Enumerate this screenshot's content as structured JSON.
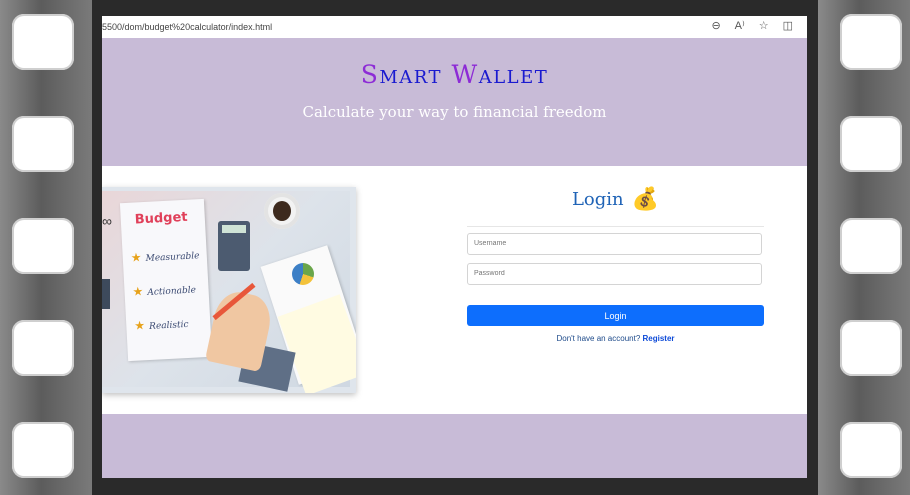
{
  "browser": {
    "url": "5500/dom/budget%20calculator/index.html",
    "icons": [
      "zoom-out-icon",
      "read-aloud-icon",
      "favorite-star-icon",
      "split-screen-icon"
    ]
  },
  "header": {
    "brand_first": "S",
    "brand_rest_a": "mart ",
    "brand_second": "W",
    "brand_rest_b": "allet",
    "tagline": "Calculate your way to financial freedom"
  },
  "hero": {
    "paper_title": "Budget",
    "items": [
      "Measurable",
      "Actionable",
      "Realistic"
    ],
    "calculator_display": "00000"
  },
  "login": {
    "title": "Login",
    "username_placeholder": "Username",
    "password_placeholder": "Password",
    "button_label": "Login",
    "register_prompt": "Don't have an account?",
    "register_link": "Register"
  },
  "colors": {
    "header_bg": "#c8bbd7",
    "brand_blue": "#1a1ad0",
    "brand_purple": "#8d2bd6",
    "login_title": "#1f63b6",
    "button_bg": "#0d6efd"
  }
}
